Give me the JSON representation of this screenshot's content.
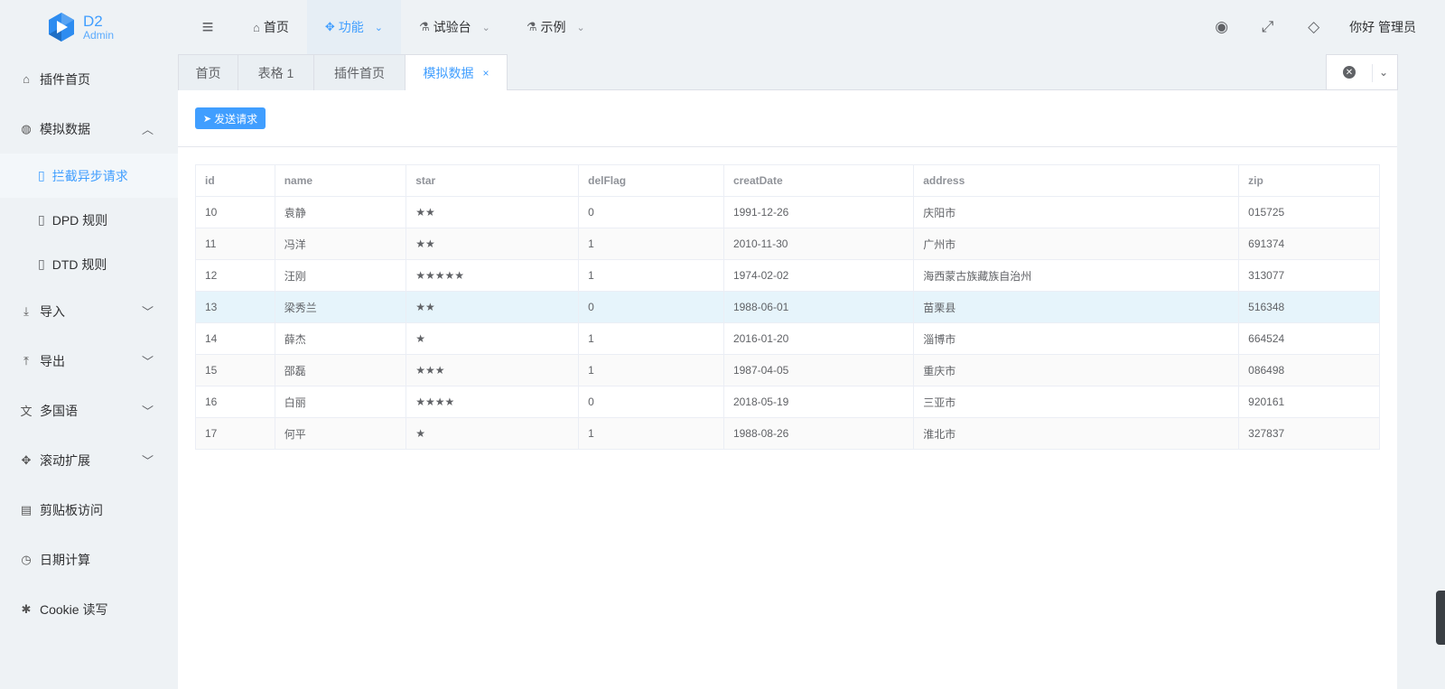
{
  "logo": {
    "main": "D2",
    "sub": "Admin"
  },
  "topmenu": [
    {
      "label": "首页",
      "icon": "home-icon",
      "glyph": "⌂",
      "active": false,
      "dropdown": false
    },
    {
      "label": "功能",
      "icon": "puzzle-icon",
      "glyph": "✥",
      "active": true,
      "dropdown": true
    },
    {
      "label": "试验台",
      "icon": "flask-icon",
      "glyph": "⚗",
      "active": false,
      "dropdown": true
    },
    {
      "label": "示例",
      "icon": "flask-icon",
      "glyph": "⚗",
      "active": false,
      "dropdown": true
    }
  ],
  "header_right": {
    "user": "你好 管理员"
  },
  "sidebar": {
    "items": [
      {
        "label": "插件首页",
        "icon": "home-icon"
      },
      {
        "label": "模拟数据",
        "icon": "globe-icon",
        "expanded": true
      },
      {
        "label": "拦截异步请求",
        "icon": "file-icon",
        "sub": true,
        "active": true
      },
      {
        "label": "DPD 规则",
        "icon": "file-icon",
        "sub": true
      },
      {
        "label": "DTD 规则",
        "icon": "file-icon",
        "sub": true
      },
      {
        "label": "导入",
        "icon": "download-icon",
        "expandable": true
      },
      {
        "label": "导出",
        "icon": "upload-icon",
        "expandable": true
      },
      {
        "label": "多国语",
        "icon": "language-icon",
        "expandable": true
      },
      {
        "label": "滚动扩展",
        "icon": "crosshair-icon",
        "expandable": true
      },
      {
        "label": "剪贴板访问",
        "icon": "clipboard-icon"
      },
      {
        "label": "日期计算",
        "icon": "clock-icon"
      },
      {
        "label": "Cookie 读写",
        "icon": "asterisk-icon"
      }
    ]
  },
  "tabs": [
    {
      "label": "首页"
    },
    {
      "label": "表格 1"
    },
    {
      "label": "插件首页"
    },
    {
      "label": "模拟数据",
      "active": true,
      "close": "×"
    }
  ],
  "toolbar": {
    "send_label": "发送请求"
  },
  "table": {
    "columns": [
      "id",
      "name",
      "star",
      "delFlag",
      "creatDate",
      "address",
      "zip"
    ],
    "rows": [
      [
        "10",
        "袁静",
        "★★",
        "0",
        "1991-12-26",
        "庆阳市",
        "015725"
      ],
      [
        "11",
        "冯洋",
        "★★",
        "1",
        "2010-11-30",
        "广州市",
        "691374"
      ],
      [
        "12",
        "汪刚",
        "★★★★★",
        "1",
        "1974-02-02",
        "海西蒙古族藏族自治州",
        "313077"
      ],
      [
        "13",
        "梁秀兰",
        "★★",
        "0",
        "1988-06-01",
        "苗栗县",
        "516348"
      ],
      [
        "14",
        "薛杰",
        "★",
        "1",
        "2016-01-20",
        "淄博市",
        "664524"
      ],
      [
        "15",
        "邵磊",
        "★★★",
        "1",
        "1987-04-05",
        "重庆市",
        "086498"
      ],
      [
        "16",
        "白丽",
        "★★★★",
        "0",
        "2018-05-19",
        "三亚市",
        "920161"
      ],
      [
        "17",
        "何平",
        "★",
        "1",
        "1988-08-26",
        "淮北市",
        "327837"
      ]
    ],
    "highlighted_row": 3
  },
  "colors": {
    "accent": "#409eff",
    "background": "#eef2f5",
    "highlight_row": "#e6f4fb"
  }
}
